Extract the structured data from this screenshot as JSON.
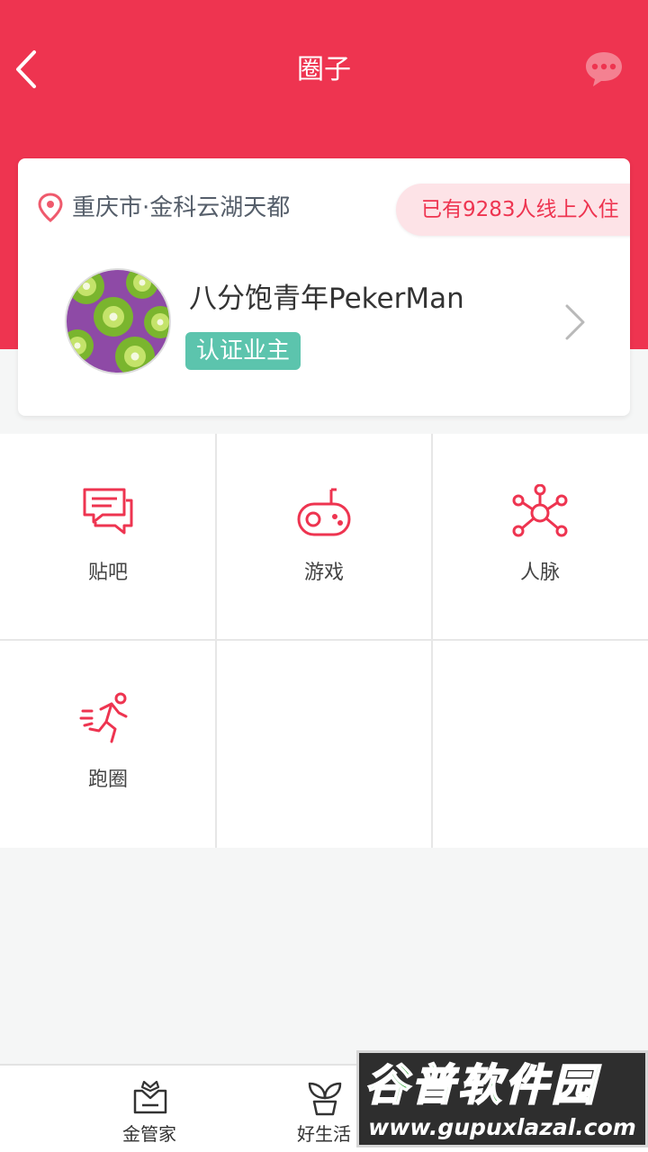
{
  "header": {
    "title": "圈子",
    "accent_color": "#ee3450"
  },
  "card": {
    "location": "重庆市·金科云湖天都",
    "resident_count_text": "已有9283人线上入住",
    "user_name": "八分饱青年PekerMan",
    "verify_badge": "认证业主",
    "verify_color": "#5cc4ad"
  },
  "grid": {
    "items": [
      {
        "label": "贴吧",
        "icon": "chat-bubbles-icon"
      },
      {
        "label": "游戏",
        "icon": "radio-game-icon"
      },
      {
        "label": "人脉",
        "icon": "network-icon"
      },
      {
        "label": "跑圈",
        "icon": "runner-icon"
      }
    ]
  },
  "tabbar": {
    "items": [
      {
        "label": "金管家",
        "icon": "gift-box-icon"
      },
      {
        "label": "好生活",
        "icon": "sprout-icon"
      }
    ]
  },
  "watermark": {
    "brand": "谷普软件园",
    "url": "www.gupuxlazal.com"
  }
}
